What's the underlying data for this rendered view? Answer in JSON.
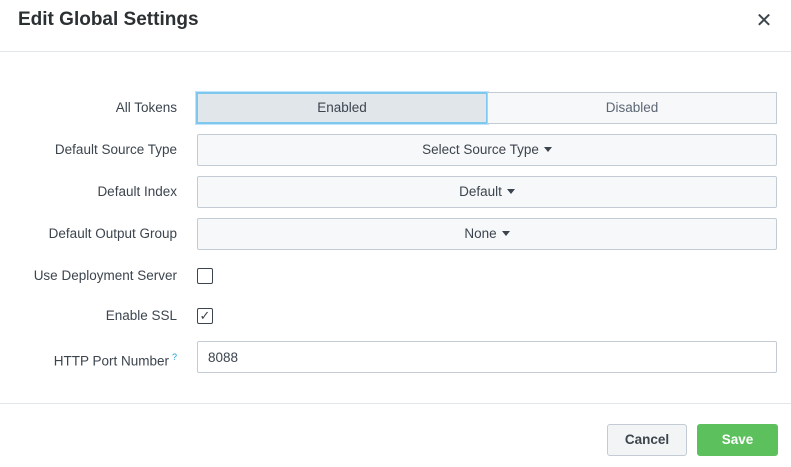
{
  "dialog": {
    "title": "Edit Global Settings",
    "close_glyph": "✕"
  },
  "form": {
    "all_tokens": {
      "label": "All Tokens",
      "options": [
        "Enabled",
        "Disabled"
      ],
      "selected": "Enabled"
    },
    "default_source_type": {
      "label": "Default Source Type",
      "value": "Select Source Type"
    },
    "default_index": {
      "label": "Default Index",
      "value": "Default"
    },
    "default_output_group": {
      "label": "Default Output Group",
      "value": "None"
    },
    "use_deployment_server": {
      "label": "Use Deployment Server",
      "checked": false
    },
    "enable_ssl": {
      "label": "Enable SSL",
      "checked": true,
      "check_glyph": "✓"
    },
    "http_port_number": {
      "label": "HTTP Port Number",
      "help": "?",
      "value": "8088"
    }
  },
  "footer": {
    "cancel_label": "Cancel",
    "save_label": "Save"
  },
  "colors": {
    "save_button": "#5cc05c",
    "active_focus_ring": "#7ec8f0",
    "help_mark": "#1a9cd8"
  }
}
